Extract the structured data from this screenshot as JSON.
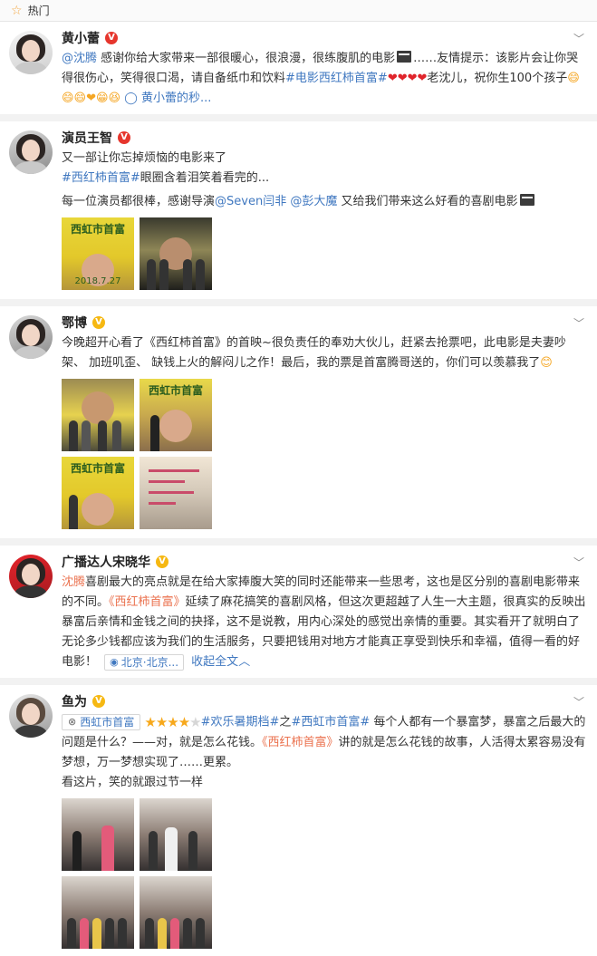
{
  "header": {
    "title": "热门",
    "star_icon": "star-icon"
  },
  "posts": [
    {
      "author": "黄小蕾",
      "badge": "V",
      "segments": {
        "mention": "@沈腾",
        "t1": " 感谢你给大家带来一部很暖心，很浪漫，很练腹肌的电影",
        "t2": "……友情提示：该影片会让你哭得很伤心，笑得很口渴，请自备纸巾和饮料",
        "tag": "#电影西红柿首富#",
        "hearts": "❤❤❤❤",
        "t3": "老沈儿，祝你生100个孩子",
        "emojis": "😄😄😄❤😁😆",
        "loop": "◯",
        "link": "黄小蕾的秒..."
      }
    },
    {
      "author": "演员王智",
      "badge": "V",
      "line1": "又一部让你忘掉烦恼的电影来了",
      "tag": "#西红柿首富#",
      "line2": "眼圈含着泪笑着看完的...",
      "line3a": "每一位演员都很棒，感谢导演",
      "m1": "@Seven闫非",
      "m2": "@彭大魔",
      "line3b": " 又给我们带来这么好看的喜剧电影",
      "img_titles": [
        "西虹市首富",
        ""
      ],
      "img_date": "2018.7.27"
    },
    {
      "author": "鄂博",
      "badge": "V",
      "t1": "今晚超开心看了《西红柿首富》的首映~很负责任的奉劝大伙儿，赶紧去抢票吧，此电影是夫妻吵架、 加班叽歪、 缺钱上火的解闷儿之作！最后，我的票是首富腾哥送的，你们可以羡慕我了",
      "emoji": "😊",
      "img_titles": [
        "",
        "西虹市首富",
        "西虹市首富",
        ""
      ]
    },
    {
      "author": "广播达人宋晓华",
      "badge": "V",
      "mention": "沈腾",
      "t1": "喜剧最大的亮点就是在给大家捧腹大笑的同时还能带来一些思考，这也是区分别的喜剧电影带来的不同。",
      "title": "《西红柿首富》",
      "t2": "延续了麻花搞笑的喜剧风格，但这次更超越了人生一大主题，很真实的反映出暴富后亲情和金钱之间的抉择，这不是说教，用内心深处的感觉出亲情的重要。其实看开了就明白了无论多少钱都应该为我们的生活服务，只要把钱用对地方才能真正享受到快乐和幸福，值得一看的好电影！",
      "location": "北京·北京...",
      "collapse": "收起全文"
    },
    {
      "author": "鱼为",
      "badge": "V",
      "movie_tag": "西虹市首富",
      "rating": "★★★★",
      "rating_half": "★",
      "tag1": "#欢乐暑期档#",
      "t_zhi": "之",
      "tag2": "#西虹市首富#",
      "t1": " 每个人都有一个暴富梦，暴富之后最大的问题是什么？——对，就是怎么花钱。",
      "title": "《西红柿首富》",
      "t2": "讲的就是怎么花钱的故事，人活得太累容易没有梦想，万一梦想实现了……更累。",
      "t3": "看这片，笑的就跟过节一样"
    }
  ]
}
